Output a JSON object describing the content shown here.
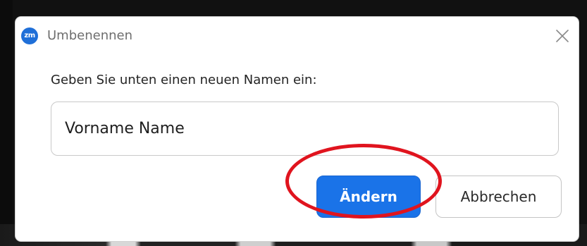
{
  "dialog": {
    "app_icon_text": "zm",
    "title": "Umbenennen",
    "close_glyph": "close-icon",
    "prompt": "Geben Sie unten einen neuen Namen ein:",
    "name_input": {
      "value": "Vorname Name",
      "placeholder": ""
    },
    "confirm_label": "Ändern",
    "cancel_label": "Abbrechen"
  },
  "colors": {
    "primary_button": "#1a73e8",
    "highlight_annotation": "#e0141e",
    "app_icon": "#1f6fd8"
  }
}
